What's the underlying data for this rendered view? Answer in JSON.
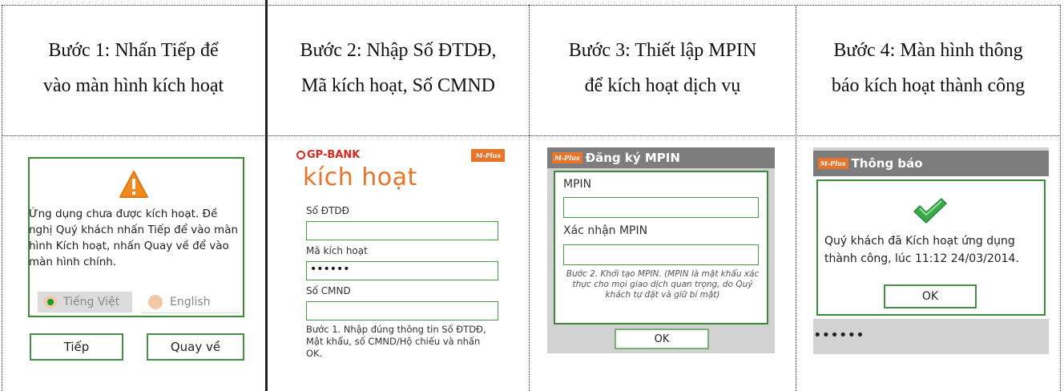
{
  "headers": [
    {
      "line1": "Bước 1: Nhấn Tiếp để",
      "line2": "vào màn hình kích hoạt"
    },
    {
      "line1": "Bước 2: Nhập Số ĐTDĐ,",
      "line2": "Mã kích hoạt, Số CMND"
    },
    {
      "line1": "Bước 3: Thiết lập MPIN",
      "line2": "để kích hoạt dịch vụ"
    },
    {
      "line1": "Bước 4: Màn hình thông",
      "line2": "báo kích hoạt thành công"
    }
  ],
  "step1": {
    "message": "Ứng dụng chưa được kích hoạt. Đề nghị Quý khách nhấn Tiếp để vào màn hình Kích hoạt, nhấn Quay về để vào màn hình chính.",
    "lang_vi": "Tiếng Việt",
    "lang_en": "English",
    "next_label": "Tiếp",
    "back_label": "Quay về"
  },
  "step2": {
    "bank_logo": "GP-BANK",
    "badge": "M-Plus",
    "title": "kích hoạt",
    "phone_label": "Số ĐTDĐ",
    "code_label": "Mã kích hoạt",
    "code_value": "••••••",
    "id_label": "Số CMND",
    "instructions": "Bước 1. Nhập đúng thông tin Số ĐTDĐ, Mật khẩu, số CMND/Hộ chiếu và nhấn OK."
  },
  "step3": {
    "badge": "M-Plus",
    "title": "Đăng ký MPIN",
    "mpin_label": "MPIN",
    "confirm_label": "Xác nhận MPIN",
    "note": "Bước 2. Khởi tạo MPIN. (MPIN là mật khẩu xác thực cho mọi giao dịch quan trọng, do Quý khách tự đặt và giữ bí mật)",
    "ok_label": "OK"
  },
  "step4": {
    "badge": "M-Plus",
    "title": "Thông báo",
    "message": "Quý khách đã Kích hoạt ứng dụng thành công, lúc 11:12 24/03/2014.",
    "ok_label": "OK",
    "dots": "••••••"
  },
  "colors": {
    "green_border": "#3a8a3a",
    "warning": "#f08a1c",
    "titlebar": "#7d7d7d",
    "brand_orange": "#e8742a"
  }
}
